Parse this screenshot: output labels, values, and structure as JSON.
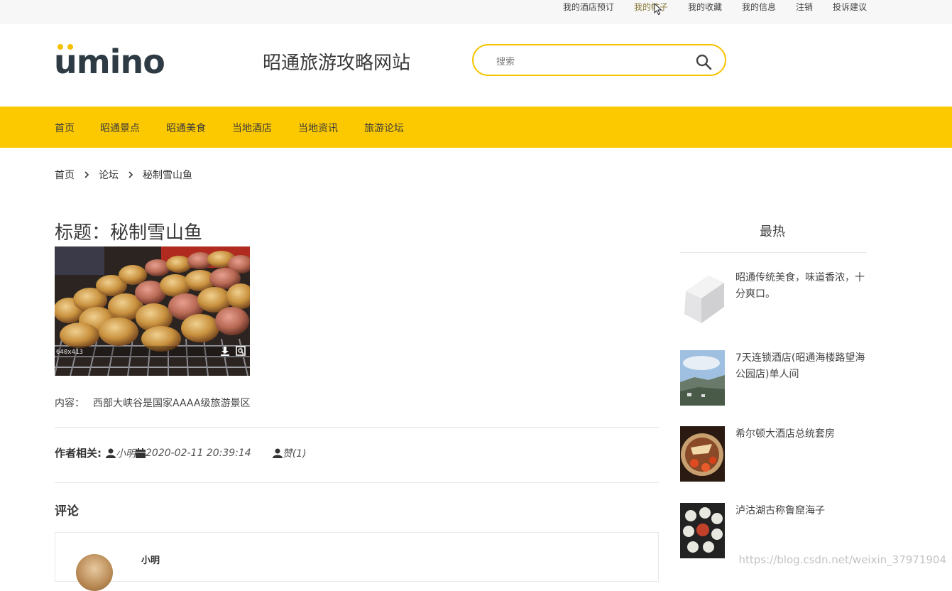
{
  "topbar": {
    "links": [
      "我的酒店预订",
      "我的帖子",
      "我的收藏",
      "我的信息",
      "注销",
      "投诉建议"
    ]
  },
  "logo": {
    "text": "umino"
  },
  "site": {
    "title": "昭通旅游攻略网站"
  },
  "search": {
    "placeholder": "搜索"
  },
  "nav": {
    "items": [
      "首页",
      "昭通景点",
      "昭通美食",
      "当地酒店",
      "当地资讯",
      "旅游论坛"
    ]
  },
  "breadcrumb": [
    "首页",
    "论坛",
    "秘制雪山鱼"
  ],
  "post": {
    "title": "标题：秘制雪山鱼",
    "image_size": "640x413",
    "content_label": "内容：",
    "content": "西部大峡谷是国家AAAA级旅游景区",
    "author_label": "作者相关:",
    "author": "小明",
    "date": "2020-02-11 20:39:14",
    "likes": "赞(1)"
  },
  "comments": {
    "title": "评论",
    "items": [
      {
        "name": "小明"
      }
    ]
  },
  "sidebar": {
    "title": "最热",
    "items": [
      {
        "text": "昭通传统美食，味道香浓，十分爽口。"
      },
      {
        "text": "7天连锁酒店(昭通海楼路望海公园店)单人间"
      },
      {
        "text": "希尔顿大酒店总统套房"
      },
      {
        "text": "泸沽湖古称鲁窟海子"
      }
    ]
  },
  "watermark": "https://blog.csdn.net/weixin_37971904",
  "colors": {
    "accent": "#fcc900",
    "search_border": "#f7c300",
    "logo_dot": "#f5c000"
  }
}
